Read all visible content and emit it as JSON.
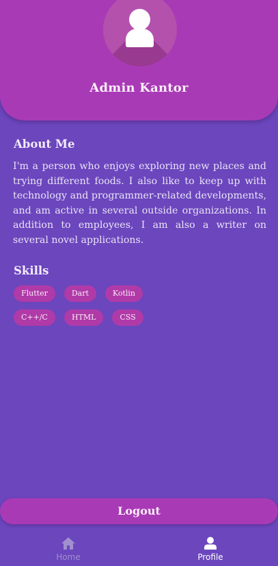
{
  "profile": {
    "name": "Admin Kantor"
  },
  "about": {
    "title": "About Me",
    "text": "I'm a person who enjoys exploring new places and trying different foods. I also like to keep up with technology and programmer-related developments, and am active in several outside organizations. In addition to employees, I am also a writer on several novel applications."
  },
  "skills": {
    "title": "Skills",
    "items": [
      "Flutter",
      "Dart",
      "Kotlin",
      "C++/C",
      "HTML",
      "CSS"
    ]
  },
  "logout_label": "Logout",
  "nav": {
    "home_label": "Home",
    "home_icon": "home-icon",
    "profile_label": "Profile",
    "profile_icon": "person-icon"
  },
  "colors": {
    "background": "#6b46bd",
    "accent": "#a93ab6",
    "chip": "#b03aa8"
  }
}
